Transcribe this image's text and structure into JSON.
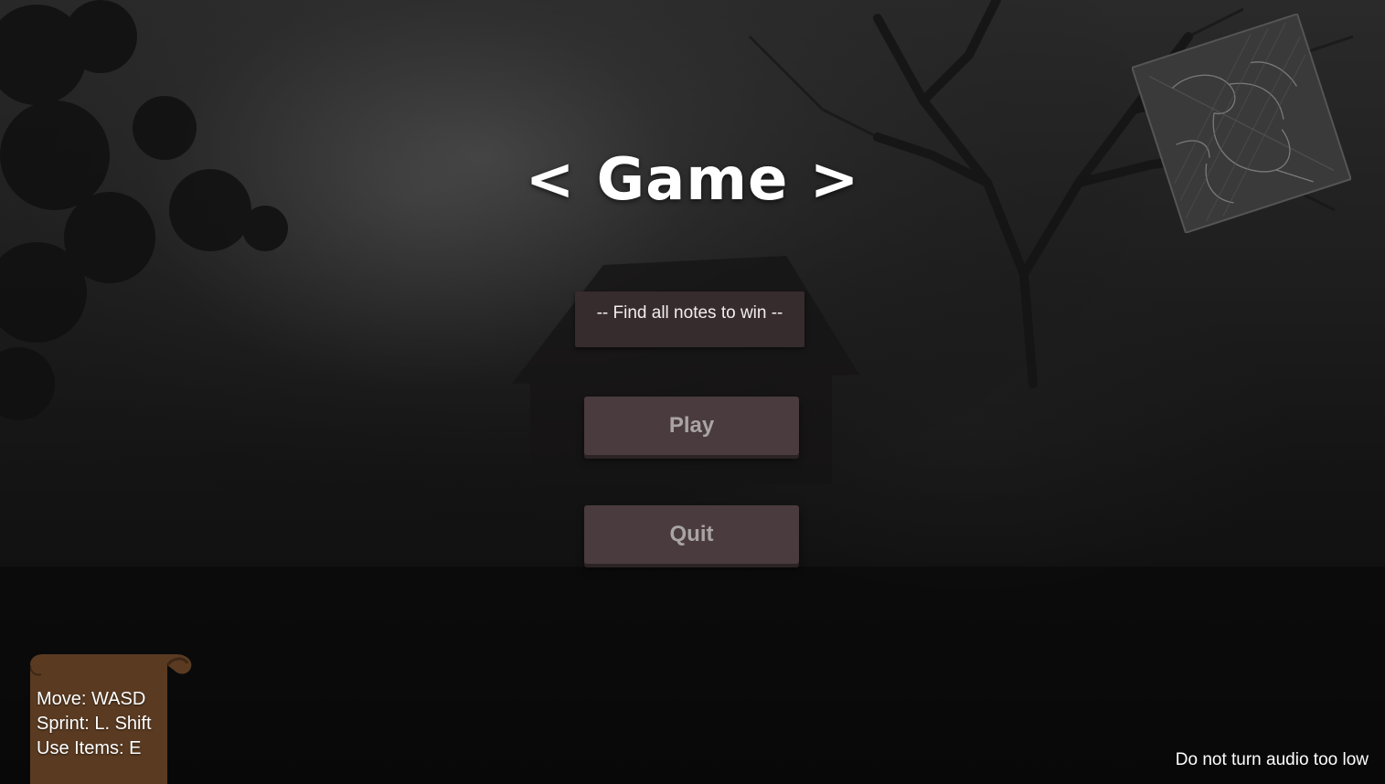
{
  "title": "< Game >",
  "objective": "-- Find all notes to win --",
  "menu": {
    "play_label": "Play",
    "quit_label": "Quit"
  },
  "controls": {
    "move": "Move: WASD",
    "sprint": "Sprint: L. Shift",
    "use_items": "Use Items: E"
  },
  "audio_hint": "Do not turn audio too low",
  "colors": {
    "button_bg": "#4a3b3e",
    "button_text": "#a9a4a6",
    "objective_bg": "#382c2e",
    "scroll": "#5a3b22"
  },
  "icons": {
    "scroll": "parchment-scroll-icon",
    "sketch": "creature-sketch-image"
  }
}
